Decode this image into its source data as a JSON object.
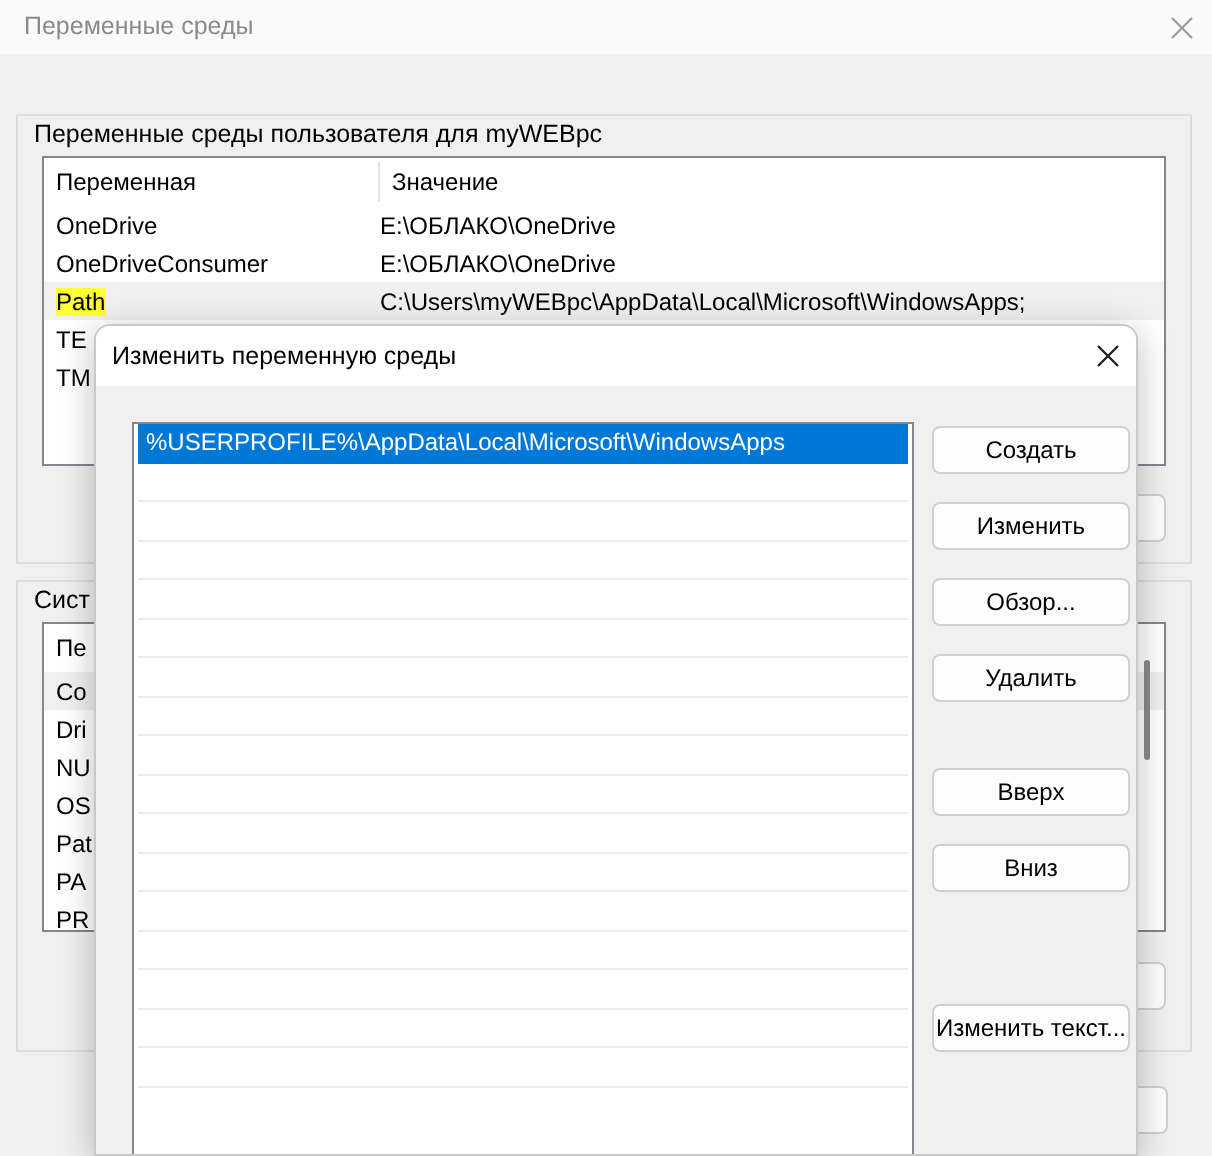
{
  "window": {
    "title": "Переменные среды"
  },
  "user_vars": {
    "legend": "Переменные среды пользователя для myWEBpc",
    "columns": [
      "Переменная",
      "Значение"
    ],
    "rows": [
      {
        "name": "OneDrive",
        "value": "E:\\ОБЛАКО\\OneDrive",
        "selected": false,
        "marked": false
      },
      {
        "name": "OneDriveConsumer",
        "value": "E:\\ОБЛАКО\\OneDrive",
        "selected": false,
        "marked": false
      },
      {
        "name": "Path",
        "value": "C:\\Users\\myWEBpc\\AppData\\Local\\Microsoft\\WindowsApps;",
        "selected": true,
        "marked": true
      },
      {
        "name": "TE",
        "selected": false,
        "marked": false
      },
      {
        "name": "TM",
        "selected": false,
        "marked": false
      }
    ]
  },
  "system_vars": {
    "legend": "Сист",
    "columns": [
      "Пе"
    ],
    "rows": [
      {
        "name": "Co",
        "selected": true
      },
      {
        "name": "Dri",
        "selected": false
      },
      {
        "name": "NU",
        "selected": false
      },
      {
        "name": "OS",
        "selected": false
      },
      {
        "name": "Pat",
        "selected": false
      },
      {
        "name": "PA",
        "selected": false
      },
      {
        "name": "PR",
        "selected": false
      }
    ]
  },
  "dialog": {
    "title": "Изменить переменную среды",
    "entries": [
      {
        "text": "%USERPROFILE%\\AppData\\Local\\Microsoft\\WindowsApps",
        "selected": true
      }
    ],
    "button_groups": [
      [
        "Создать",
        "Изменить",
        "Обзор...",
        "Удалить"
      ],
      [
        "Вверх",
        "Вниз"
      ],
      [
        "Изменить текст..."
      ]
    ]
  }
}
